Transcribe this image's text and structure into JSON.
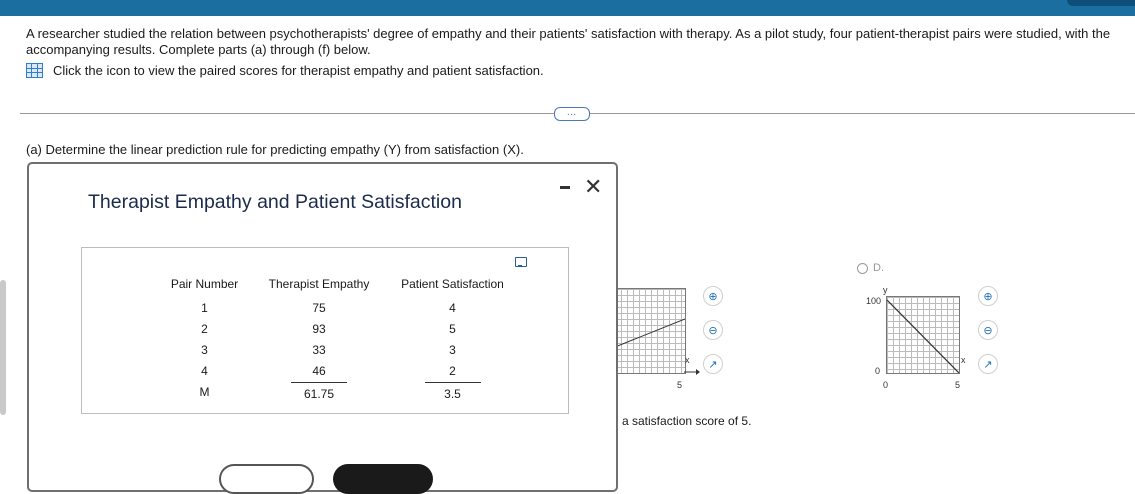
{
  "question": {
    "text": "A researcher studied the relation between psychotherapists' degree of empathy and their patients' satisfaction with therapy. As a pilot study, four patient-therapist pairs were studied, with the accompanying results. Complete parts (a) through (f) below.",
    "data_link": "Click the icon to view the paired scores for therapist empathy and patient satisfaction."
  },
  "more_button": "…",
  "part_a": "(a) Determine the linear prediction rule for predicting empathy (Y) from satisfaction (X).",
  "background": {
    "option_d": "D.",
    "axis_y_top": "100",
    "axis_zero_y": "0",
    "axis_zero_x": "0",
    "axis_five": "5",
    "axis_x_label": "x",
    "axis_y_label": "y",
    "partial_text": "a satisfaction score of 5."
  },
  "popup": {
    "title": "Therapist Empathy and Patient Satisfaction",
    "close_symbol": "✕",
    "columns": [
      "Pair Number",
      "Therapist Empathy",
      "Patient Satisfaction"
    ],
    "rows": [
      [
        "1",
        "75",
        "4"
      ],
      [
        "2",
        "93",
        "5"
      ],
      [
        "3",
        "33",
        "3"
      ],
      [
        "4",
        "46",
        "2"
      ]
    ],
    "mean_row": [
      "M",
      "61.75",
      "3.5"
    ]
  },
  "colors": {
    "top_bar": "#1a6ea0",
    "link_icon": "#2f7ec7",
    "title_text": "#1c2b4a"
  }
}
